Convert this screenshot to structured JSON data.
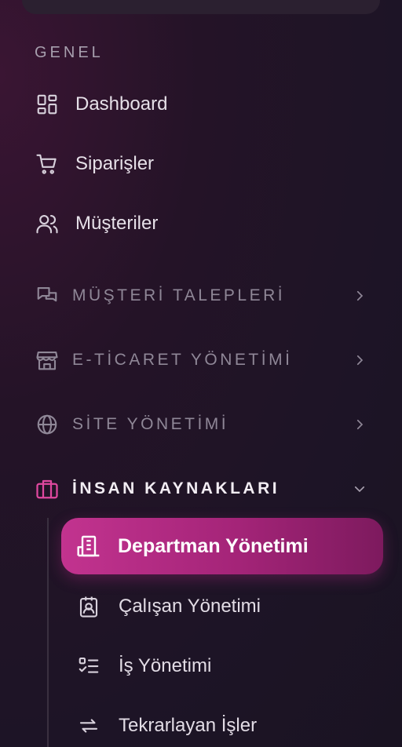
{
  "sidebar": {
    "section_label": "GENEL",
    "main_items": [
      {
        "label": "Dashboard",
        "icon": "dashboard-grid-icon"
      },
      {
        "label": "Siparişler",
        "icon": "cart-icon"
      },
      {
        "label": "Müşteriler",
        "icon": "users-icon"
      }
    ],
    "groups": [
      {
        "label": "MÜŞTERİ TALEPLERİ",
        "icon": "chat-bubbles-icon",
        "expanded": false
      },
      {
        "label": "E-TİCARET YÖNETİMİ",
        "icon": "store-icon",
        "expanded": false
      },
      {
        "label": "SİTE YÖNETİMİ",
        "icon": "globe-icon",
        "expanded": false
      },
      {
        "label": "İNSAN KAYNAKLARI",
        "icon": "briefcase-icon",
        "expanded": true
      }
    ],
    "sub_items": [
      {
        "label": "Departman Yönetimi",
        "icon": "building-icon",
        "active": true
      },
      {
        "label": "Çalışan Yönetimi",
        "icon": "id-badge-icon",
        "active": false
      },
      {
        "label": "İş Yönetimi",
        "icon": "checklist-icon",
        "active": false
      },
      {
        "label": "Tekrarlayan İşler",
        "icon": "repeat-icon",
        "active": false
      }
    ]
  },
  "colors": {
    "accent": "#c2338f",
    "accent_icon": "#e0489f",
    "muted_text": "#8f8797"
  }
}
